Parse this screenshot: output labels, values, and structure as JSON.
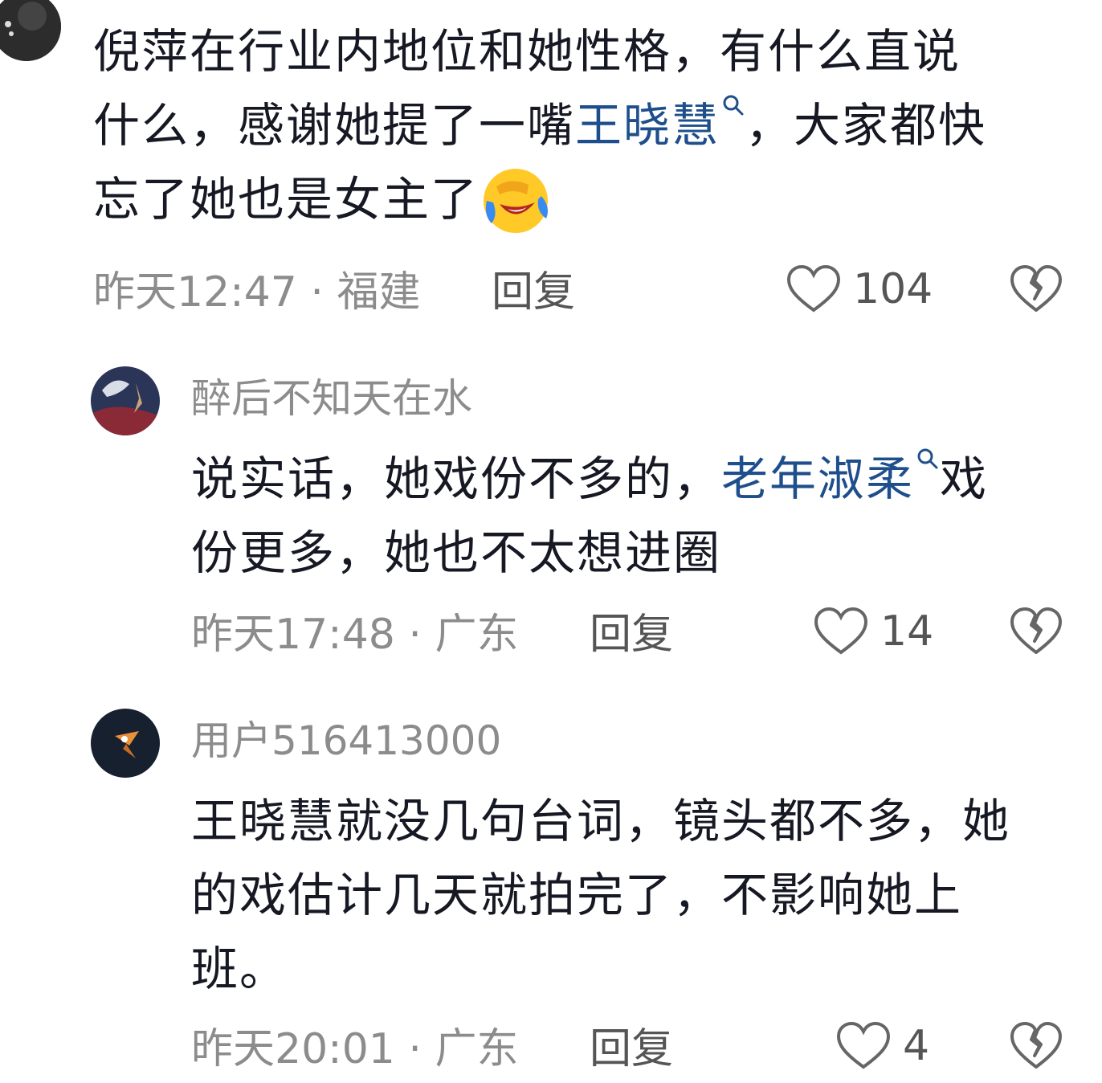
{
  "comments": [
    {
      "lines": [
        [
          "倪萍在行业内地位和她性格，有什么直说"
        ],
        [
          "什么，感谢她提了一嘴",
          {
            "link": "王晓慧"
          },
          "，大家都快"
        ],
        [
          "忘了她也是女主了"
        ]
      ],
      "emoji": "laughing-crying-emoji",
      "time": "昨天12:47",
      "location": "福建",
      "reply_label": "回复",
      "likes": "104"
    },
    {
      "username": "醉后不知天在水",
      "lines": [
        [
          "说实话，她戏份不多的，",
          {
            "link": "老年淑柔"
          },
          "戏"
        ],
        [
          "份更多，她也不太想进圈"
        ]
      ],
      "time": "昨天17:48",
      "location": "广东",
      "reply_label": "回复",
      "likes": "14"
    },
    {
      "username": "用户516413000",
      "lines": [
        [
          "王晓慧就没几句台词，镜头都不多，她"
        ],
        [
          "的戏估计几天就拍完了，不影响她上"
        ],
        [
          "班。"
        ]
      ],
      "time": "昨天20:01",
      "location": "广东",
      "reply_label": "回复",
      "likes": "4"
    }
  ],
  "separator": "·",
  "icons": {
    "like": "heart-outline-icon",
    "dislike": "broken-heart-icon",
    "search": "search-icon"
  },
  "colors": {
    "link": "#1e4f8c",
    "meta": "#8c8c8c"
  }
}
